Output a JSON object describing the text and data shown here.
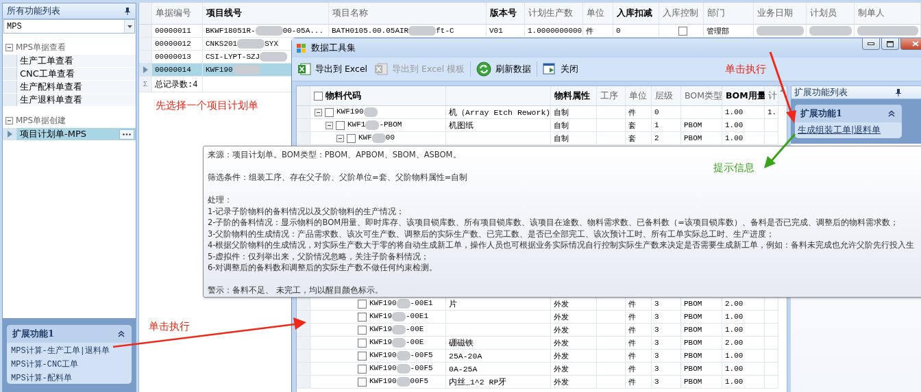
{
  "sidebar": {
    "title": "所有功能列表",
    "filter": {
      "value": "MPS"
    },
    "groups": [
      {
        "label": "MPS单据查看",
        "expanded": true,
        "items": [
          {
            "label": "生产工单查看",
            "selected": false
          },
          {
            "label": "CNC工单查看",
            "selected": false
          },
          {
            "label": "生产配料单查看",
            "selected": false
          },
          {
            "label": "生产退料单查看",
            "selected": false
          }
        ]
      },
      {
        "label": "MPS单据创建",
        "expanded": true,
        "items": [
          {
            "label": "项目计划单-MPS",
            "selected": true
          }
        ]
      }
    ],
    "extension_panel": {
      "title": "扩展功能1",
      "links": [
        "MPS计算-生产工单|退料单",
        "MPS计算-CNC工单",
        "MPS计算-配料单"
      ]
    }
  },
  "table": {
    "columns": [
      {
        "label": "单据编号",
        "bold": false
      },
      {
        "label": "项目线号",
        "bold": true
      },
      {
        "label": "项目名称",
        "bold": false
      },
      {
        "label": "版本号",
        "bold": true
      },
      {
        "label": "计划生产数",
        "bold": false
      },
      {
        "label": "单位",
        "bold": false
      },
      {
        "label": "入库扣减",
        "bold": true
      },
      {
        "label": "入库控制",
        "bold": false
      },
      {
        "label": "部门",
        "bold": false
      },
      {
        "label": "业务日期",
        "bold": false
      },
      {
        "label": "计划员",
        "bold": false
      },
      {
        "label": "制单人",
        "bold": false
      }
    ],
    "rows": [
      {
        "selected": false,
        "cells": [
          "00000011",
          [
            "BKWF18051R-",
            "00-05A..."
          ],
          [
            "BATH0105.00.05AIR",
            "ft-C"
          ],
          "V01",
          "1.0000000000",
          "件",
          "0",
          {
            "kind": "checkbox",
            "checked": false
          },
          "管理部",
          {
            "kind": "redacted"
          },
          {
            "kind": "redacted"
          },
          {
            "kind": "redacted"
          }
        ]
      },
      {
        "selected": false,
        "cells": [
          "00000012",
          [
            "CNKS201",
            "SYX"
          ]
        ]
      },
      {
        "selected": false,
        "cells": [
          "00000013",
          [
            "CSI-LYPT-SZJ"
          ]
        ]
      },
      {
        "selected": true,
        "cells": [
          "00000014",
          [
            "KWF190"
          ]
        ]
      }
    ],
    "footer": {
      "symbol": "Σ",
      "text": "总记录数:4"
    }
  },
  "annotations": [
    {
      "kind": "instruction",
      "text": "先选择一个项目计划单"
    },
    {
      "kind": "instruction",
      "text": "单击执行"
    },
    {
      "kind": "instruction",
      "text": "单击执行"
    },
    {
      "kind": "hint",
      "text": "提示信息"
    }
  ],
  "dialog": {
    "title": "数据工具集",
    "toolbar": [
      {
        "kind": "excel",
        "label": "导出到 Excel",
        "disabled": false
      },
      {
        "kind": "excel",
        "label": "导出到 Excel 模板",
        "disabled": true
      },
      {
        "kind": "refresh",
        "label": "刷新数据",
        "disabled": false
      },
      {
        "kind": "close",
        "label": "关闭",
        "disabled": false
      }
    ],
    "grid": {
      "columns": [
        {
          "label": "物料代码",
          "bold": true,
          "checked": false
        },
        {},
        {
          "label": "物料属性",
          "bold": true
        },
        {
          "label": "工序",
          "bold": false
        },
        {
          "label": "单位",
          "bold": false
        },
        {
          "label": "层级",
          "bold": false
        },
        {
          "label": "BOM类型",
          "bold": false
        },
        {
          "label": "BOM用量",
          "bold": true
        },
        {
          "label": "计",
          "bold": false
        }
      ],
      "rows": [
        {
          "code": [
            "KWF190"
          ],
          "name": "机（Array Etch Rework)",
          "attribute": "自制",
          "unit": "件",
          "level": "0",
          "bom_qty": "1.00",
          "plan": "1.",
          "checked": false,
          "expanded": true,
          "children": [
            {
              "code": [
                "KWF1",
                "-PBOM"
              ],
              "name": "机图纸",
              "attribute": "自制",
              "unit": "套",
              "level": "1",
              "bom_type": "PBOM",
              "bom_qty": "1.00",
              "checked": false,
              "expanded": true,
              "children": [
                {
                  "code": [
                    "KWF",
                    "00"
                  ],
                  "attribute": "自制",
                  "unit": "套",
                  "level": "2",
                  "bom_type": "PBOM",
                  "bom_qty": "1.00",
                  "checked": false,
                  "expanded": true,
                  "children": [
                    {
                      "code": [
                        "KWF190",
                        "-00E1"
                      ],
                      "name": "片",
                      "attribute": "外发",
                      "unit": "件",
                      "level": "3",
                      "bom_type": "PBOM",
                      "bom_qty": "2.00",
                      "checked": false
                    },
                    {
                      "code": [
                        "KWF19",
                        "-00E1"
                      ],
                      "attribute": "外发",
                      "unit": "件",
                      "level": "3",
                      "bom_type": "PBOM",
                      "bom_qty": "1.00",
                      "checked": false
                    },
                    {
                      "code": [
                        "KWF19",
                        "-00E"
                      ],
                      "attribute": "外发",
                      "unit": "件",
                      "level": "3",
                      "bom_type": "PBOM",
                      "bom_qty": "1.00",
                      "checked": false
                    },
                    {
                      "code": [
                        "KWF19",
                        "-00E"
                      ],
                      "name": "硼磁铁",
                      "attribute": "外发",
                      "unit": "件",
                      "level": "3",
                      "bom_type": "PBOM",
                      "bom_qty": "2.00",
                      "checked": false
                    },
                    {
                      "code": [
                        "KWF190",
                        "-00F5"
                      ],
                      "name": "25A-20A",
                      "attribute": "外发",
                      "unit": "件",
                      "level": "3",
                      "bom_type": "PBOM",
                      "bom_qty": "1.00",
                      "checked": false
                    },
                    {
                      "code": [
                        "KWF190",
                        "-00F5"
                      ],
                      "name": "0A-25A",
                      "attribute": "外发",
                      "unit": "件",
                      "level": "3",
                      "bom_type": "PBOM",
                      "bom_qty": "1.00",
                      "checked": false
                    },
                    {
                      "code": [
                        "KWF190",
                        "00F5"
                      ],
                      "name": "内丝_1^2 RP牙",
                      "attribute": "外发",
                      "unit": "件",
                      "level": "3",
                      "bom_type": "PBOM",
                      "bom_qty": "1.00",
                      "checked": false
                    }
                  ]
                }
              ]
            }
          ]
        }
      ]
    },
    "extension_panel": {
      "title": "扩展功能列表",
      "group": "扩展功能1",
      "links": [
        "生成组装工单|退料单"
      ]
    }
  },
  "tooltip": {
    "paragraphs": [
      [
        "来源：项目计划单。BOM类型：PBOM、APBOM、SBOM、ASBOM。"
      ],
      [
        "筛选条件：组装工序、存在父子阶、父阶单位=套、父阶物料属性=自制"
      ],
      [
        "处理：",
        "1-记录子阶物料的备料情况以及父阶物料的生产情况；",
        "2-子阶的备料情况：显示物料的BOM用量、即时库存、该项目锁库数、所有项目锁库数、该项目在途数、物料需求数、已备料数（=该项目锁库数）、备料是否已完成、调整后的物料需求数；",
        "3-父阶物料的生成情况：产品需求数、该次可生产数、调整后的实际生产数、已完工数、是否已全部完工、该次预计工时、所有工单实际总工时、生产进度；",
        "4-根据父阶物料的生成情况，对实际生产数大于零的将自动生成新工单，操作人员也可根据业务实际情况自行控制实际生产数来决定是否需要生成新工单，例如：备料未完成也允许父阶先行投入生",
        "5-虚拟件：仅列举出来，父阶情况忽略，关注子阶备料情况；",
        "6-对调整后的备料数和调整后的实际生产数不做任何约束检测。"
      ],
      [
        "警示：备料不足、 未完工，均以醒目颜色标示。"
      ]
    ]
  }
}
